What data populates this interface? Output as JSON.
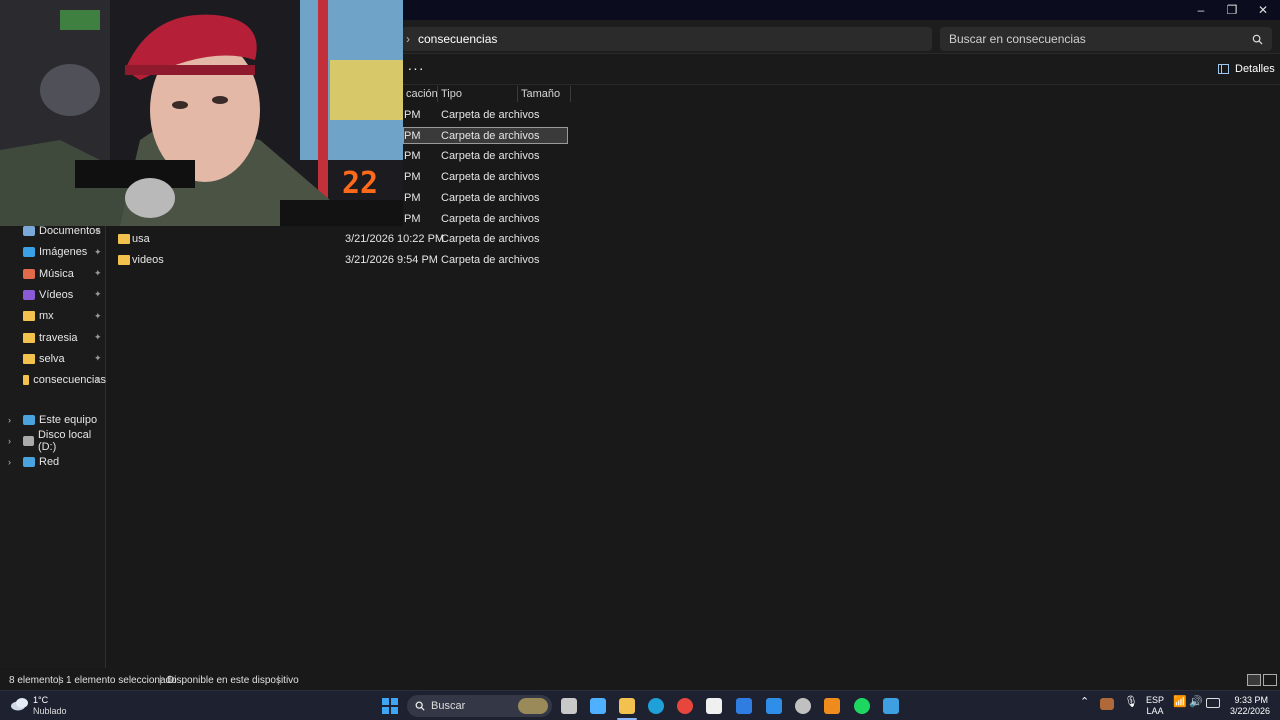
{
  "window": {
    "minimize": "–",
    "maximize": "❐",
    "close": "✕"
  },
  "address": {
    "chevron": "›",
    "crumb": "consecuencias"
  },
  "search": {
    "placeholder": "Buscar en consecuencias",
    "icon": "search-icon"
  },
  "toolbar": {
    "more_label": "···",
    "details_label": "Detalles"
  },
  "columns": {
    "date": "cación",
    "type": "Tipo",
    "size": "Tamaño"
  },
  "rows": [
    {
      "name": "",
      "date": "PM",
      "type": "Carpeta de archivos"
    },
    {
      "name": "",
      "date": "PM",
      "type": "Carpeta de archivos",
      "selected": true
    },
    {
      "name": "",
      "date": "PM",
      "type": "Carpeta de archivos"
    },
    {
      "name": "",
      "date": "PM",
      "type": "Carpeta de archivos"
    },
    {
      "name": "",
      "date": "PM",
      "type": "Carpeta de archivos"
    },
    {
      "name": "",
      "date": "PM",
      "type": "Carpeta de archivos"
    },
    {
      "name": "usa",
      "date": "3/21/2026 10:22 PM",
      "type": "Carpeta de archivos"
    },
    {
      "name": "videos",
      "date": "3/21/2026 9:54 PM",
      "type": "Carpeta de archivos"
    }
  ],
  "sidebar": {
    "items": [
      {
        "label": "Documentos",
        "icon": "document-icon",
        "color": "#7aa8d8"
      },
      {
        "label": "Imágenes",
        "icon": "pictures-icon",
        "color": "#3aa0e8"
      },
      {
        "label": "Música",
        "icon": "music-icon",
        "color": "#e06b4a"
      },
      {
        "label": "Vídeos",
        "icon": "videos-icon",
        "color": "#8b5ad8"
      },
      {
        "label": "mx",
        "icon": "folder-icon",
        "color": "#f2c14e"
      },
      {
        "label": "travesia",
        "icon": "folder-icon",
        "color": "#f2c14e"
      },
      {
        "label": "selva",
        "icon": "folder-icon",
        "color": "#f2c14e"
      },
      {
        "label": "consecuencias",
        "icon": "folder-icon",
        "color": "#f2c14e"
      }
    ],
    "pin": "📌",
    "tree": [
      {
        "label": "Este equipo",
        "icon": "computer-icon"
      },
      {
        "label": "Disco local (D:)",
        "icon": "drive-icon"
      },
      {
        "label": "Red",
        "icon": "network-icon"
      }
    ],
    "expand": "›"
  },
  "status": {
    "count": "8 elementos",
    "selected": "1 elemento seleccionado",
    "availability": "Disponible en este dispositivo",
    "sep": "|"
  },
  "taskbar": {
    "weather_temp": "1°C",
    "weather_desc": "Nublado",
    "search_label": "Buscar",
    "lang_top": "ESP",
    "lang_bottom": "LAA",
    "time": "9:33 PM",
    "date": "3/22/2026",
    "apps": [
      {
        "icon": "start-icon",
        "color": "#3ea6f5"
      },
      {
        "icon": "widgets-icon",
        "color": "#c9c9c9"
      },
      {
        "icon": "news-icon",
        "color": "#4fb0ff"
      },
      {
        "icon": "file-explorer-icon",
        "color": "#f2c14e"
      },
      {
        "icon": "edge-icon",
        "color": "#1fa0d8"
      },
      {
        "icon": "chrome-icon",
        "color": "#e8453c"
      },
      {
        "icon": "store-icon",
        "color": "#f0f0f0"
      },
      {
        "icon": "app-icon",
        "color": "#2f7de1"
      },
      {
        "icon": "mail-icon",
        "color": "#2f8fe8"
      },
      {
        "icon": "steam-icon",
        "color": "#c0c0c0"
      },
      {
        "icon": "fl-studio-icon",
        "color": "#f08c1e"
      },
      {
        "icon": "spotify-icon",
        "color": "#1ed760"
      },
      {
        "icon": "paint-icon",
        "color": "#3ea0e0"
      }
    ]
  },
  "webcam": {
    "overlay_text": "22"
  }
}
